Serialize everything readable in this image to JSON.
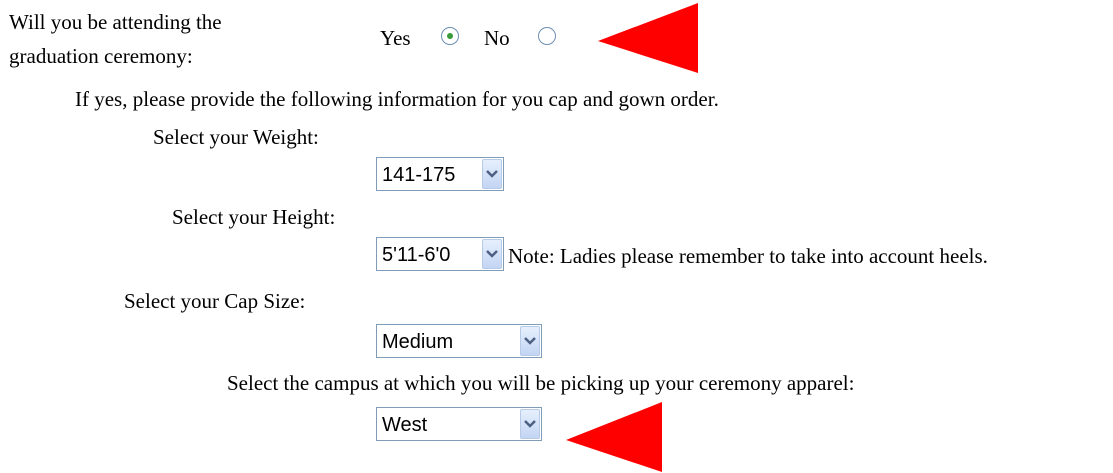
{
  "question": {
    "line1": "Will you be attending the",
    "line2": "graduation ceremony:"
  },
  "attending": {
    "yes_label": "Yes",
    "no_label": "No",
    "selected": "Yes"
  },
  "intro": "If yes, please provide the following information for you cap and gown order.",
  "weight": {
    "label": "Select your Weight:",
    "value": "141-175"
  },
  "height": {
    "label": "Select your Height:",
    "value": "5'11-6'0",
    "note": "Note: Ladies please remember to take into account heels."
  },
  "cap": {
    "label": "Select your Cap Size:",
    "value": "Medium"
  },
  "campus": {
    "label": "Select the campus at which you will be picking up your ceremony apparel:",
    "value": "West"
  },
  "colors": {
    "annotation_arrow": "#ff0000",
    "radio_dot": "#3a9a3a",
    "select_border": "#7f9db9"
  },
  "icons": [
    "chevron-down-icon",
    "annotation-arrow-icon"
  ]
}
